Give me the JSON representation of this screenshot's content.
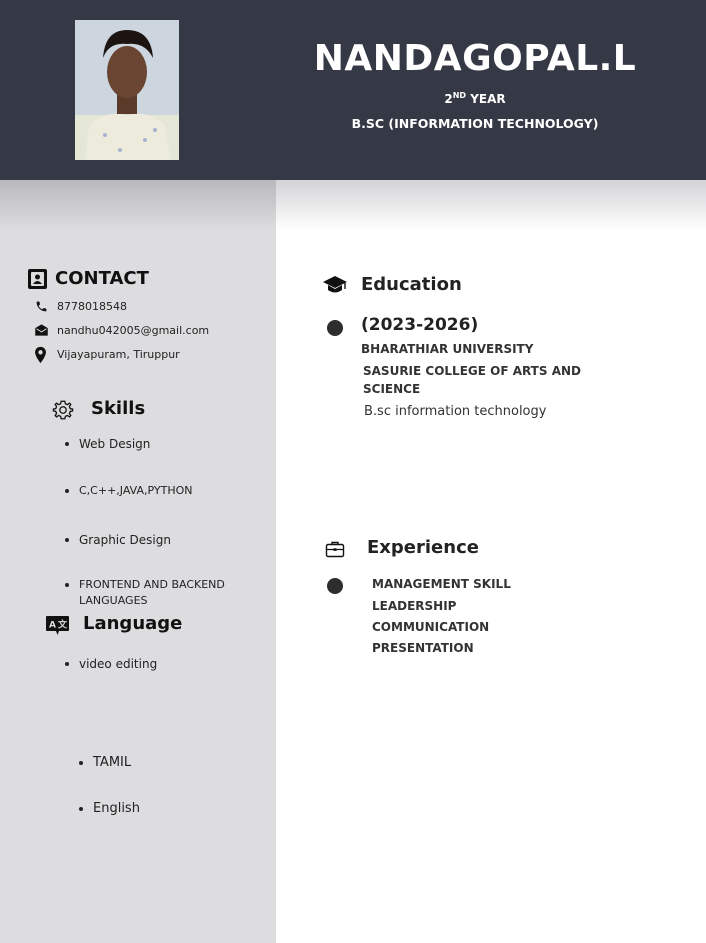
{
  "header": {
    "name": "NANDAGOPAL.L",
    "year_sup": "ND",
    "year_num": "2",
    "year_text": "YEAR",
    "degree": "B.SC (INFORMATION TECHNOLOGY)"
  },
  "contact": {
    "heading": "CONTACT",
    "phone": "8778018548",
    "email": "nandhu042005@gmail.com",
    "address": "Vijayapuram, Tiruppur"
  },
  "skills": {
    "heading": "Skills",
    "items": [
      "Web Design",
      "C,C++,JAVA,PYTHON",
      "Graphic Design",
      "FRONTEND AND BACKEND LANGUAGES",
      "video editing"
    ]
  },
  "language": {
    "heading": "Language",
    "items": [
      "TAMIL",
      "English"
    ]
  },
  "education": {
    "heading": "Education",
    "period": "(2023-2026)",
    "university": "BHARATHIAR UNIVERSITY",
    "college": "SASURIE COLLEGE OF ARTS AND SCIENCE",
    "course": "B.sc information technology"
  },
  "experience": {
    "heading": "Experience",
    "items": [
      "MANAGEMENT SKILL",
      "LEADERSHIP",
      "COMMUNICATION",
      "PRESENTATION"
    ]
  },
  "colors": {
    "header_bg": "#353845",
    "sidebar_bg": "#dddcdf",
    "text_dark": "#2b2b2b"
  }
}
